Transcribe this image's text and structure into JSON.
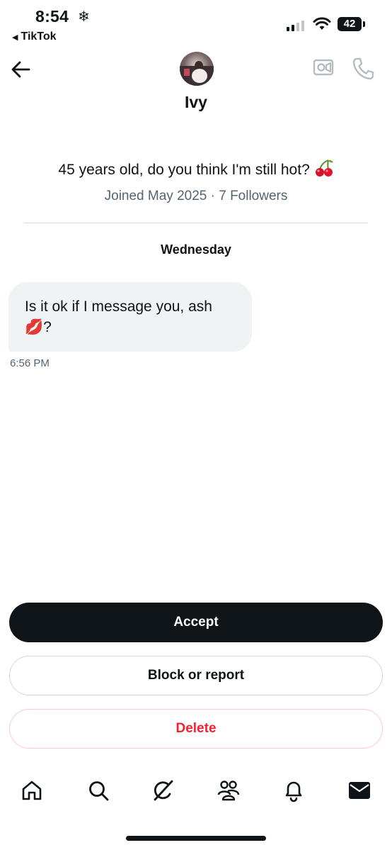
{
  "status_bar": {
    "time": "8:54",
    "weather_symbol": "❄",
    "back_app_label": "TikTok",
    "battery": "42"
  },
  "header": {
    "name": "Ivy"
  },
  "profile": {
    "bio": "45 years old, do you think I'm still hot?",
    "bio_emoji": "cherries",
    "meta": "Joined May 2025 · 7 Followers"
  },
  "conversation": {
    "day_label": "Wednesday",
    "messages": [
      {
        "text_line1": "Is it ok if I message you, ash",
        "text_line2": "💋?",
        "time": "6:56 PM"
      }
    ]
  },
  "actions": {
    "accept": "Accept",
    "block_report": "Block or report",
    "delete": "Delete"
  },
  "nav": {
    "items": [
      "home-icon",
      "search-icon",
      "grok-icon",
      "communities-icon",
      "notifications-icon",
      "messages-icon"
    ]
  },
  "colors": {
    "text": "#0f1419",
    "secondary": "#536471",
    "bubble": "#eff3f4",
    "delete_red": "#f4212e"
  }
}
